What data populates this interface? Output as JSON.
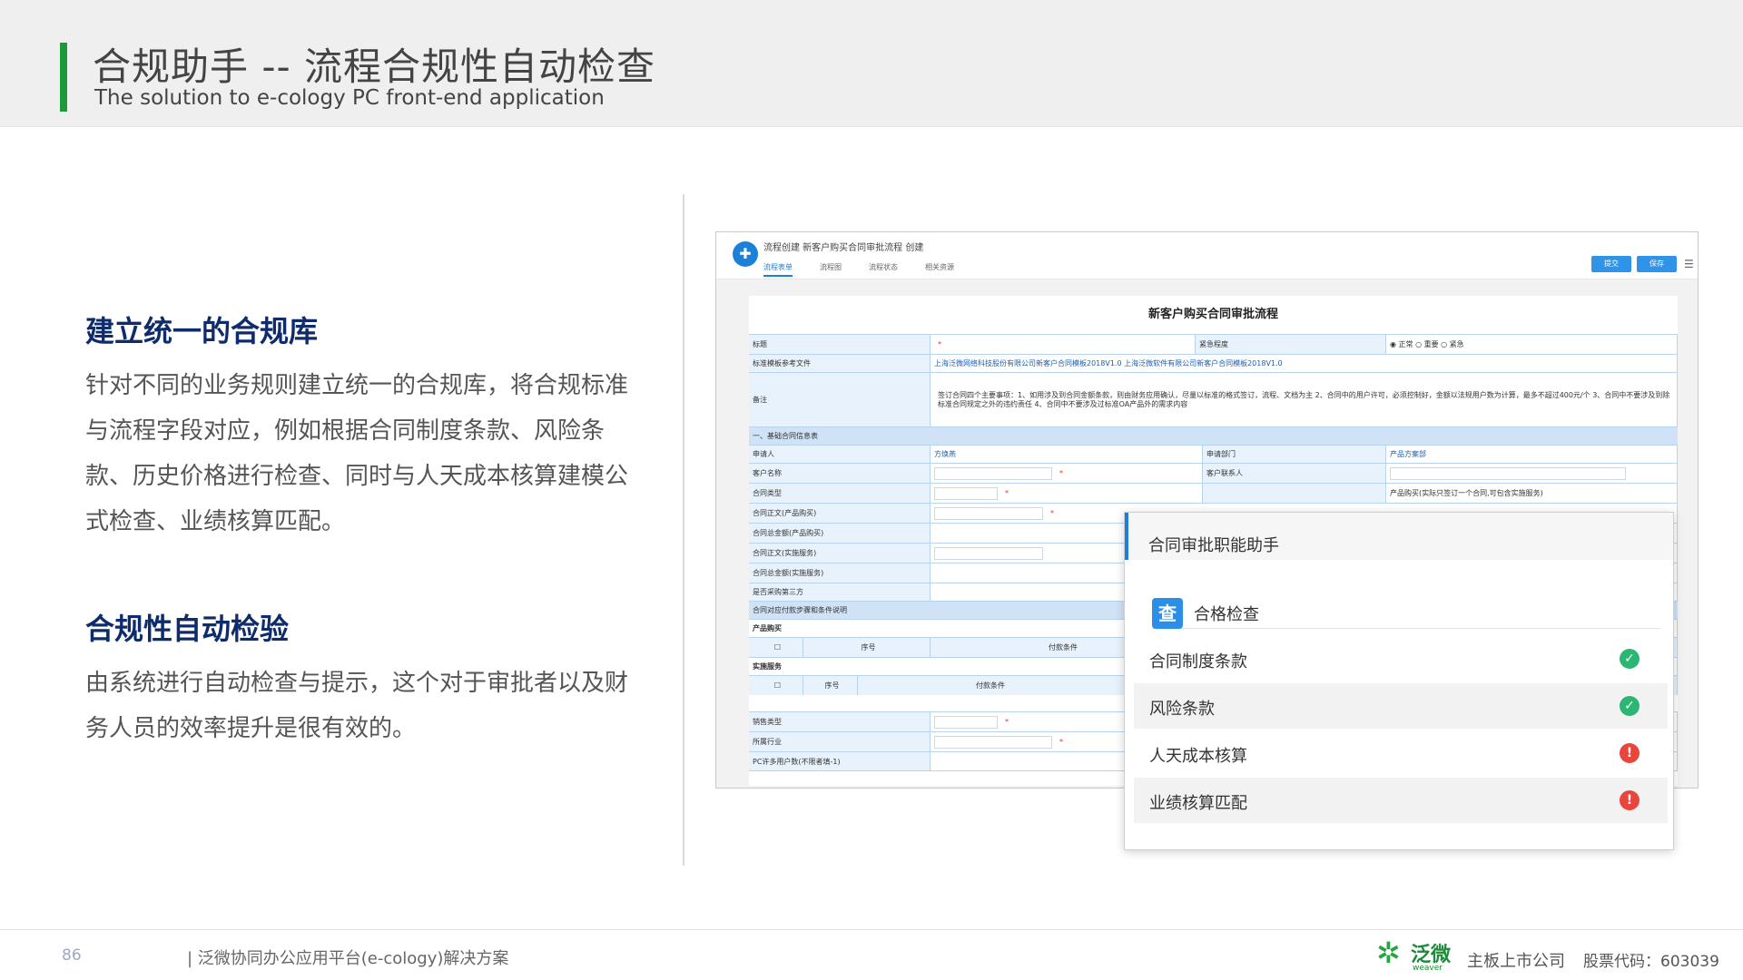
{
  "header": {
    "title": "合规助手 -- 流程合规性自动检查",
    "subtitle": "The solution to e-cology PC front-end application"
  },
  "sections": [
    {
      "heading": "建立统一的合规库",
      "body": "针对不同的业务规则建立统一的合规库，将合规标准与流程字段对应，例如根据合同制度条款、风险条款、历史价格进行检查、同时与人天成本核算建模公式检查、业绩核算匹配。"
    },
    {
      "heading": "合规性自动检验",
      "body": "由系统进行自动检查与提示，这个对于审批者以及财务人员的效率提升是很有效的。"
    }
  ],
  "screenshot": {
    "breadcrumb": "流程创建  新客户购买合同审批流程  创建",
    "tabs": [
      "流程表单",
      "流程图",
      "流程状态",
      "相关资源"
    ],
    "submit_label": "提交",
    "save_label": "保存",
    "form_title": "新客户购买合同审批流程",
    "rows": {
      "title_label": "标题",
      "urgency_label": "紧急程度",
      "urgency_options": "◉ 正常  ○ 重要  ○ 紧急",
      "template_label": "标准模板参考文件",
      "template_value": "上海泛微网络科技股份有限公司新客户合同模板2018V1.0  上海泛微软件有限公司新客户合同模板2018V1.0",
      "memo_label": "备注",
      "memo_value": "签订合同四个主要事项：1、如用涉及到合同金额条款，则由财务应用确认，尽量以标准的格式签订，流程、文档为主 2、合同中的用户许可，必须控制好，金额以法规用户数为计算，最多不超过400元/个 3、合同中不要涉及到除标准合同规定之外的违约责任 4、合同中不要涉及过标准OA产品外的需求内容",
      "section_basic": "一、基础合同信息表",
      "applicant_label": "申请人",
      "applicant_value": "方焕燕",
      "dept_label": "申请部门",
      "dept_value": "产品方案部",
      "customer_label": "客户名称",
      "contact_label": "客户联系人",
      "contract_type_label": "合同类型",
      "contract_type_value": "产品购买(实际只签订一个合同,可包含实施服务)",
      "contract_text_product": "合同正文(产品购买)",
      "contract_amount_product": "合同总金额(产品购买)",
      "contract_text_service": "合同正文(实施服务)",
      "contract_amount_service": "合同总金额(实施服务)",
      "third_party": "是否采购第三方",
      "payment_section": "合同对应付款步骤和条件说明",
      "product_purchase": "产品购买",
      "seq": "序号",
      "payment_cond": "付款条件",
      "service": "实施服务",
      "sales_type": "销售类型",
      "industry": "所属行业",
      "users": "PC许多用户数(不限者填-1)"
    }
  },
  "assistant": {
    "title": "合同审批职能助手",
    "check_icon": "查",
    "check_title": "合格检查",
    "items": [
      {
        "label": "合同制度条款",
        "status": "pass"
      },
      {
        "label": "风险条款",
        "status": "pass"
      },
      {
        "label": "人天成本核算",
        "status": "fail"
      },
      {
        "label": "业绩核算匹配",
        "status": "fail"
      }
    ],
    "pass_glyph": "✓",
    "fail_glyph": "!",
    "colors": {
      "pass": "#2bb673",
      "fail": "#e8453c"
    }
  },
  "footer": {
    "page_number": "86",
    "product_text": "| 泛微协同办公应用平台(e-cology)解决方案",
    "brand_name": "泛微",
    "brand_sub": "weaver",
    "company_text": "主板上市公司",
    "stock_text": "股票代码：603039"
  },
  "colors": {
    "accent_green": "#1f9a3b",
    "heading_navy": "#0e2b6b",
    "link_blue": "#1a80d8"
  }
}
